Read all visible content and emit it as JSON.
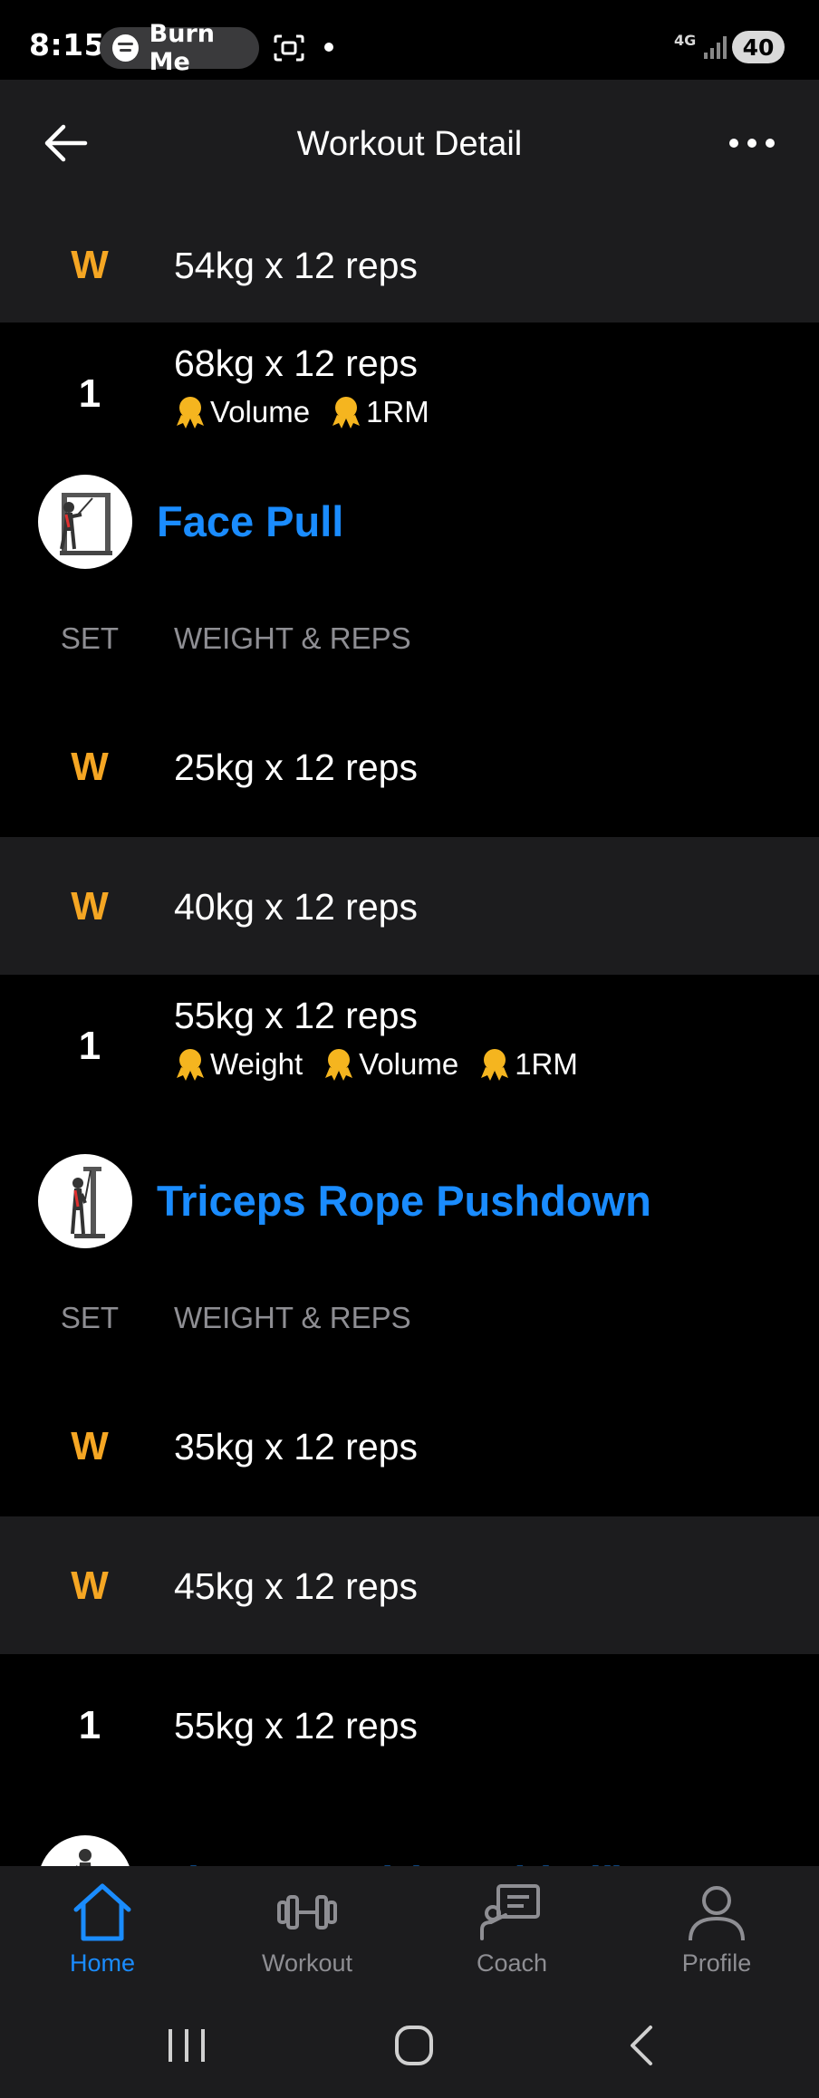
{
  "status_bar": {
    "time": "8:15",
    "spotify_label": "Burn Me",
    "network": "4G",
    "battery": "40"
  },
  "header": {
    "title": "Workout Detail"
  },
  "columns": {
    "set": "SET",
    "weight_reps": "WEIGHT & REPS"
  },
  "top_sets": [
    {
      "set": "W",
      "value": "54kg x 12 reps"
    },
    {
      "set": "1",
      "value": "68kg x 12 reps",
      "badges": [
        "Volume",
        "1RM"
      ]
    }
  ],
  "exercises": [
    {
      "name": "Face Pull",
      "sets": [
        {
          "set": "W",
          "value": "25kg x 12 reps"
        },
        {
          "set": "W",
          "value": "40kg x 12 reps"
        },
        {
          "set": "1",
          "value": "55kg x 12 reps",
          "badges": [
            "Weight",
            "Volume",
            "1RM"
          ]
        }
      ]
    },
    {
      "name": "Triceps Rope Pushdown",
      "sets": [
        {
          "set": "W",
          "value": "35kg x 12 reps"
        },
        {
          "set": "W",
          "value": "45kg x 12 reps"
        },
        {
          "set": "1",
          "value": "55kg x 12 reps"
        }
      ]
    },
    {
      "name": "Biceps Curl (Dumbbell)"
    }
  ],
  "bottom_nav": [
    {
      "label": "Home",
      "icon": "home-icon",
      "active": true
    },
    {
      "label": "Workout",
      "icon": "dumbbell-icon",
      "active": false
    },
    {
      "label": "Coach",
      "icon": "coach-icon",
      "active": false
    },
    {
      "label": "Profile",
      "icon": "profile-icon",
      "active": false
    }
  ],
  "colors": {
    "accent": "#1a8cff",
    "warmup": "#f5a623",
    "badge": "#f5b51f",
    "row_alt": "#1c1c1e",
    "muted": "#8e8e93"
  }
}
